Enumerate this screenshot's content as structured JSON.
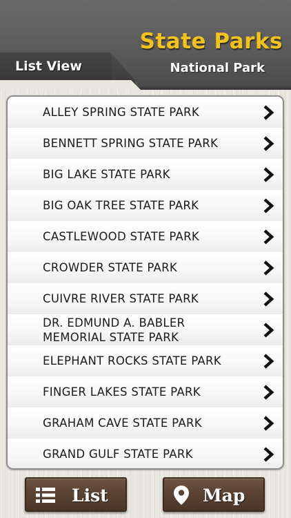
{
  "header": {
    "title": "State Parks",
    "subtitle": "National Park",
    "view_tab": "List View"
  },
  "parks": [
    "ALLEY SPRING STATE PARK",
    "BENNETT SPRING STATE PARK",
    "BIG LAKE STATE PARK",
    "BIG OAK TREE STATE PARK",
    "CASTLEWOOD STATE PARK",
    "CROWDER STATE PARK",
    "CUIVRE RIVER STATE PARK",
    "DR. EDMUND A. BABLER MEMORIAL STATE PARK",
    "ELEPHANT ROCKS STATE PARK",
    "FINGER LAKES STATE PARK",
    "GRAHAM CAVE STATE PARK",
    "GRAND GULF STATE PARK"
  ],
  "row_icon": "chevron-right-icon",
  "bottom_bar": {
    "list_label": "List",
    "list_icon": "list-icon",
    "map_label": "Map",
    "map_icon": "map-pin-icon"
  },
  "colors": {
    "title": "#f5c21a",
    "header_bg": "#5b5b5b",
    "button_bg": "#5a4333"
  }
}
